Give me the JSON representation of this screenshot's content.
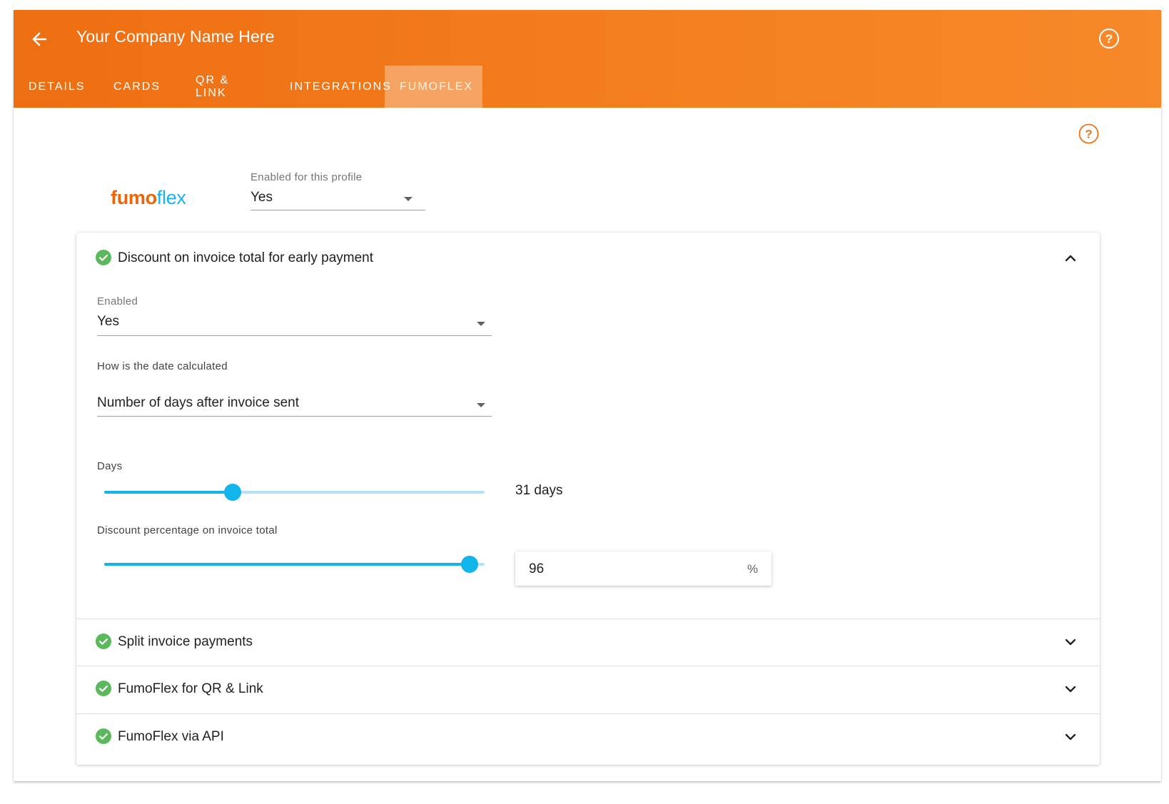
{
  "header": {
    "title": "Your Company Name Here",
    "back_icon": "arrow-back-icon",
    "help_icon": "help-circle-icon"
  },
  "tabs": [
    {
      "label": "DETAILS",
      "active": false
    },
    {
      "label": "CARDS",
      "active": false
    },
    {
      "label": "QR & LINK",
      "active": false
    },
    {
      "label": "INTEGRATIONS",
      "active": false
    },
    {
      "label": "FUMOFLEX",
      "active": true
    }
  ],
  "logo": {
    "part1": "fumo",
    "part2": "flex"
  },
  "profile_select": {
    "label": "Enabled for this profile",
    "value": "Yes"
  },
  "sections": [
    {
      "title": "Discount on invoice total for early payment",
      "expanded": true
    },
    {
      "title": "Split invoice payments",
      "expanded": false
    },
    {
      "title": "FumoFlex for QR & Link",
      "expanded": false
    },
    {
      "title": "FumoFlex via API",
      "expanded": false
    }
  ],
  "discount": {
    "enabled_label": "Enabled",
    "enabled_value": "Yes",
    "date_calc_label": "How is the date calculated",
    "date_calc_value": "Number of days after invoice sent",
    "days_label": "Days",
    "days_slider_fraction": 0.337,
    "days_display": "31 days",
    "pct_label": "Discount percentage on invoice total",
    "pct_slider_fraction": 0.96,
    "pct_value": "96",
    "pct_unit": "%"
  },
  "colors": {
    "accent_orange": "#ef7318",
    "slider_blue": "#12b5eb",
    "check_green": "#5cb85c",
    "logo_flex": "#1ab4e8"
  }
}
